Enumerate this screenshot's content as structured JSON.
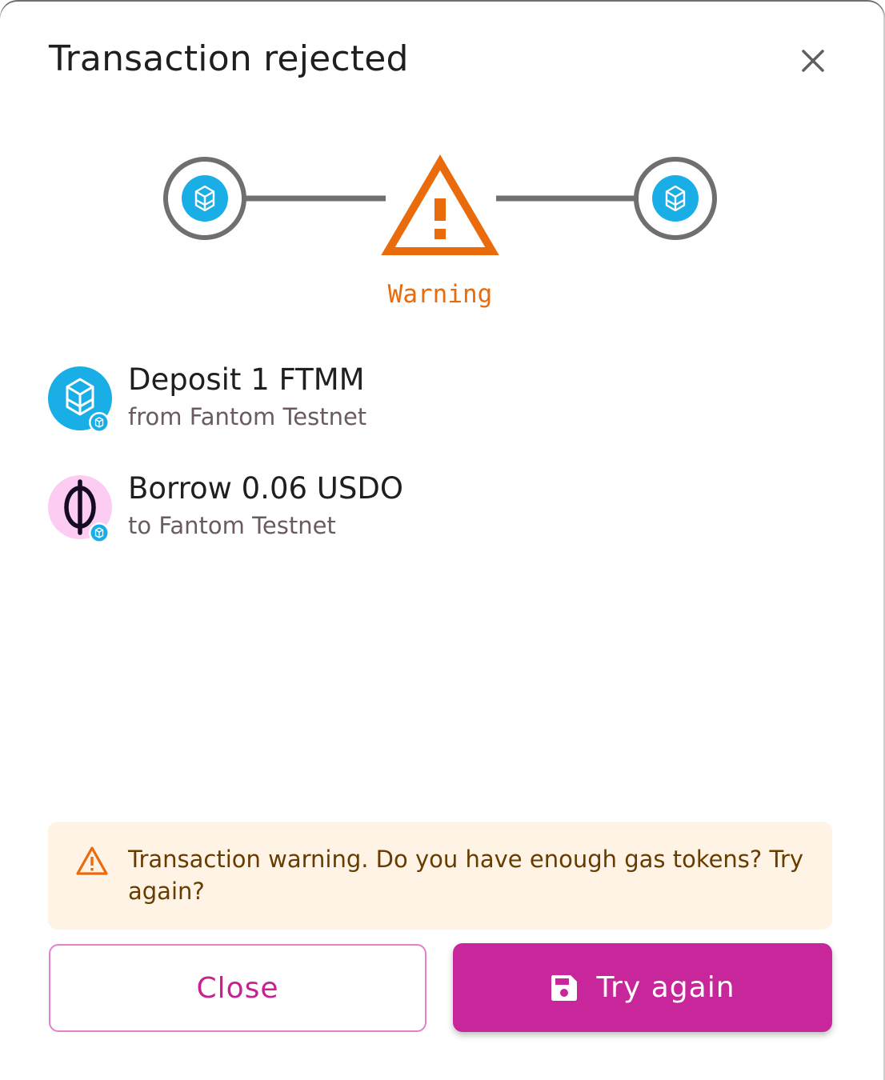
{
  "dialog": {
    "title": "Transaction rejected",
    "close_icon": "close-icon"
  },
  "stepper": {
    "status_label": "Warning",
    "status_icon": "warning-triangle-icon",
    "from_icon": "fantom-icon",
    "to_icon": "fantom-icon",
    "status_color": "#ea6b0b"
  },
  "transactions": [
    {
      "title": "Deposit 1 FTMM",
      "subtitle": "from Fantom Testnet",
      "token_icon": "fantom-icon",
      "chain_icon": "fantom-icon"
    },
    {
      "title": "Borrow 0.06 USDO",
      "subtitle": "to Fantom Testnet",
      "token_icon": "usdo-icon",
      "chain_icon": "fantom-icon"
    }
  ],
  "alert": {
    "icon": "warning-icon",
    "message": "Transaction warning. Do you have enough gas tokens? Try again?"
  },
  "actions": {
    "close_label": "Close",
    "try_again_label": "Try again",
    "try_again_icon": "save-icon"
  },
  "colors": {
    "fantom_blue": "#1aaee6",
    "primary_pink": "#c8269b",
    "warning_orange": "#ea6b0b",
    "alert_bg": "#fff3e5"
  }
}
